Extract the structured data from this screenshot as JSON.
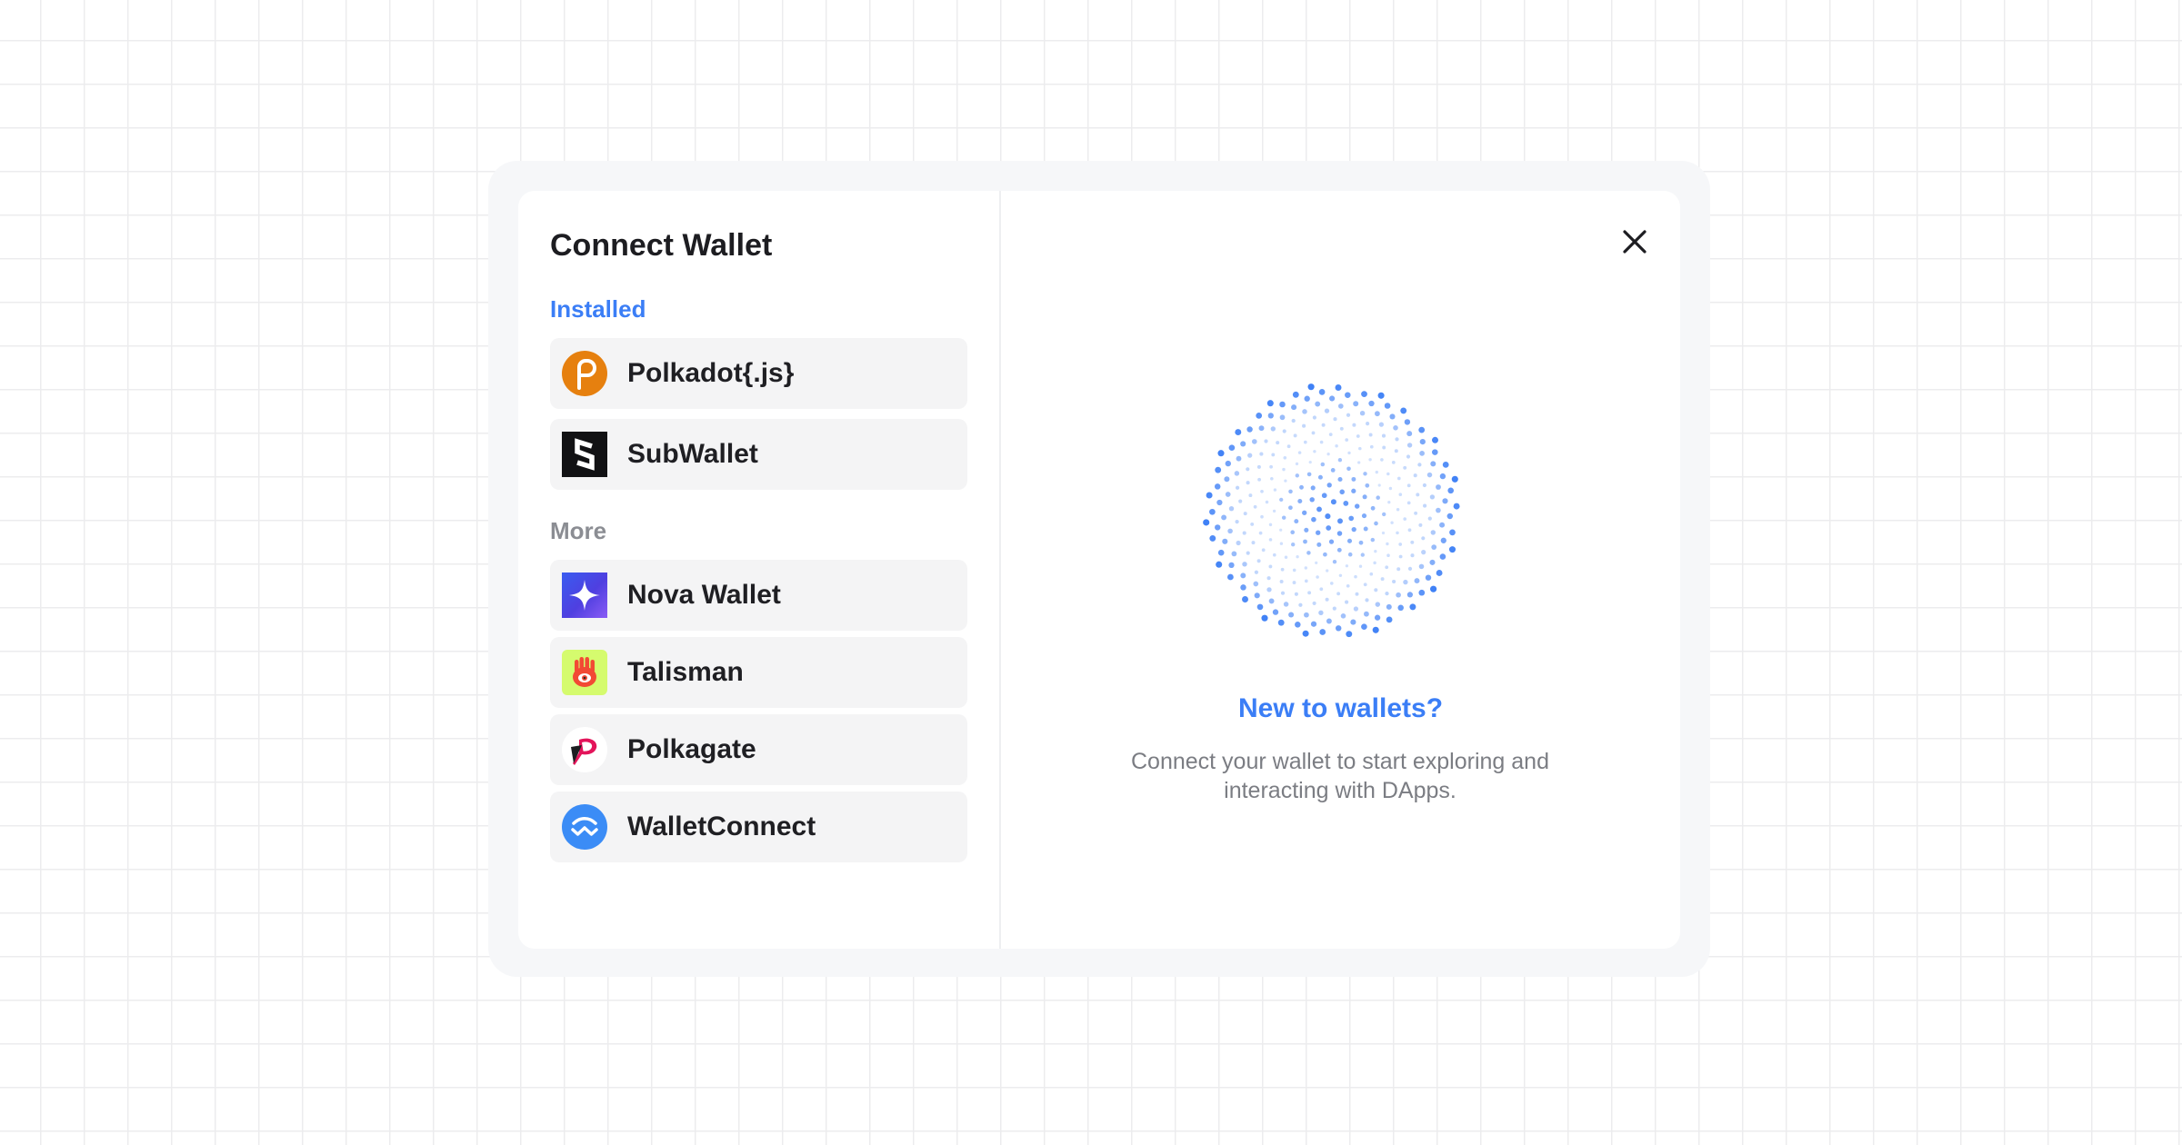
{
  "modal": {
    "title": "Connect Wallet"
  },
  "sections": {
    "installed_label": "Installed",
    "more_label": "More"
  },
  "installed_wallets": [
    {
      "name": "Polkadot{.js}",
      "icon": "polkadot-js-icon"
    },
    {
      "name": "SubWallet",
      "icon": "subwallet-icon"
    }
  ],
  "more_wallets": [
    {
      "name": "Nova Wallet",
      "icon": "nova-wallet-icon"
    },
    {
      "name": "Talisman",
      "icon": "talisman-icon"
    },
    {
      "name": "Polkagate",
      "icon": "polkagate-icon"
    },
    {
      "name": "WalletConnect",
      "icon": "walletconnect-icon"
    }
  ],
  "promo": {
    "title": "New to wallets?",
    "description": "Connect your wallet to start exploring and interacting with DApps."
  },
  "colors": {
    "accent": "#3b7ef6",
    "muted_text": "#7b7d83",
    "item_background": "#f4f4f5",
    "frame_background": "#f6f7f9"
  },
  "close_icon": "close-icon"
}
